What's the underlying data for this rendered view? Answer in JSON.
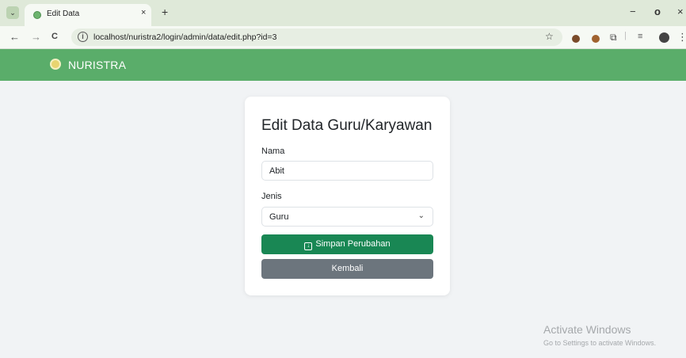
{
  "browser": {
    "tab_title": "Edit Data",
    "tab_close": "×",
    "new_tab": "+",
    "url": "localhost/nuristra2/login/admin/data/edit.php?id=3",
    "window_controls": {
      "minimize": "−",
      "restore": "o",
      "close": "×"
    },
    "nav": {
      "back": "←",
      "forward": "→",
      "reload": "C"
    }
  },
  "navbar": {
    "brand": "NURISTRA",
    "color": "#5aad6a"
  },
  "form": {
    "title": "Edit Data Guru/Karyawan",
    "nama_label": "Nama",
    "nama_value": "Abit",
    "jenis_label": "Jenis",
    "jenis_value": "Guru",
    "save_label": "Simpan Perubahan",
    "back_label": "Kembali"
  },
  "colors": {
    "save": "#198754",
    "back": "#6c757d"
  },
  "watermark": {
    "line1": "Activate Windows",
    "line2": "Go to Settings to activate Windows."
  }
}
